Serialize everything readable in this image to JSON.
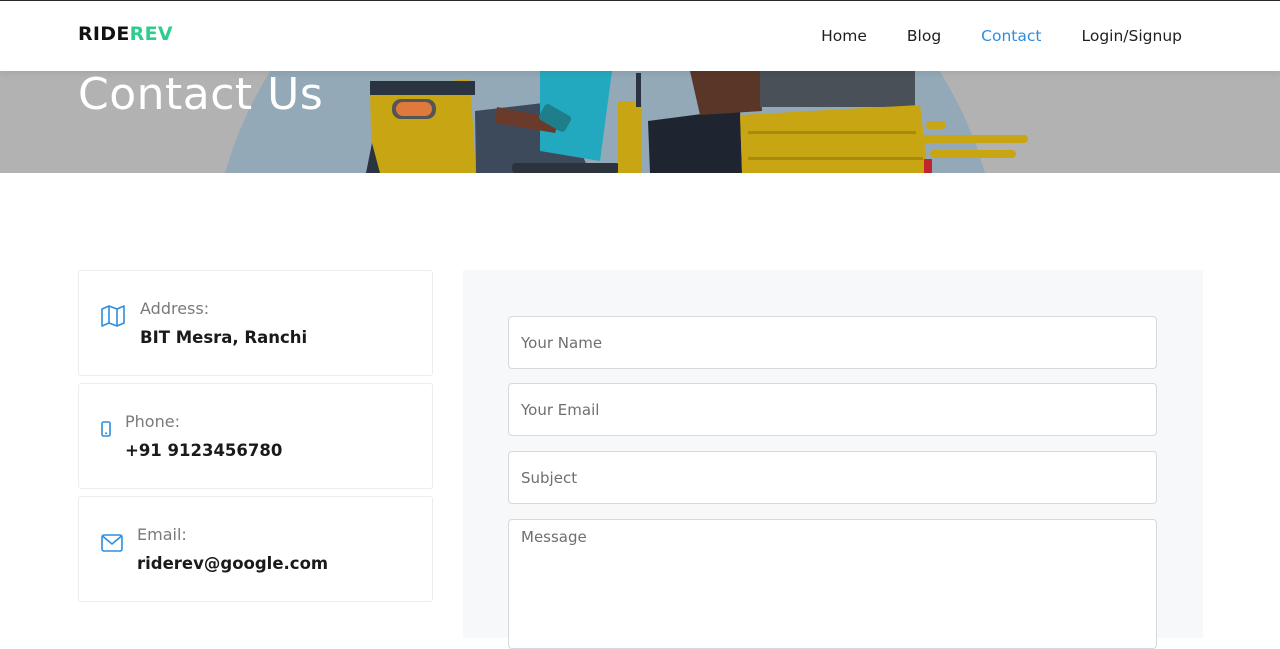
{
  "brand": {
    "part1": "RIDE",
    "part2": "REV",
    "color_part2": "#2ecc8f"
  },
  "nav": {
    "items": [
      {
        "label": "Home",
        "active": false
      },
      {
        "label": "Blog",
        "active": false
      },
      {
        "label": "Contact",
        "active": true
      },
      {
        "label": "Login/Signup",
        "active": false
      }
    ],
    "active_color": "#2d8ee0"
  },
  "hero": {
    "title": "Contact Us"
  },
  "contact_info": [
    {
      "label": "Address:",
      "value": "BIT Mesra, Ranchi",
      "icon": "map-icon"
    },
    {
      "label": "Phone:",
      "value": "+91 9123456780",
      "icon": "phone-icon"
    },
    {
      "label": "Email:",
      "value": "riderev@google.com",
      "icon": "envelope-icon"
    }
  ],
  "form": {
    "name_placeholder": "Your Name",
    "email_placeholder": "Your Email",
    "subject_placeholder": "Subject",
    "message_placeholder": "Message"
  },
  "colors": {
    "icon_blue": "#2d8ee0",
    "hero_gray": "#b2b2b2",
    "rickshaw_yellow": "#c9a514"
  }
}
